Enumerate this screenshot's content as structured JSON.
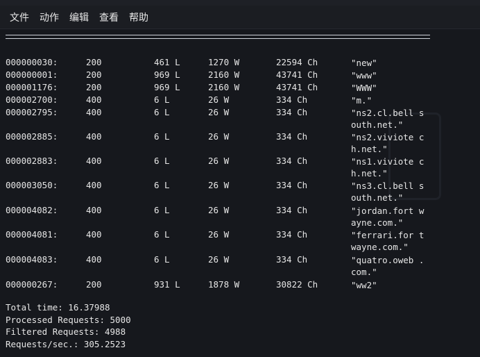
{
  "menu": {
    "items": [
      "文件",
      "动作",
      "编辑",
      "查看",
      "帮助"
    ]
  },
  "results": [
    {
      "id": "000000030:",
      "response": "200",
      "lines": "461 L",
      "words": "1270 W",
      "chars": "22594 Ch",
      "payload": "\"new\""
    },
    {
      "id": "000000001:",
      "response": "200",
      "lines": "969 L",
      "words": "2160 W",
      "chars": "43741 Ch",
      "payload": "\"www\""
    },
    {
      "id": "000001176:",
      "response": "200",
      "lines": "969 L",
      "words": "2160 W",
      "chars": "43741 Ch",
      "payload": "\"WWW\""
    },
    {
      "id": "000002700:",
      "response": "400",
      "lines": "6 L",
      "words": "26 W",
      "chars": "334 Ch",
      "payload": "\"m.\""
    },
    {
      "id": "000002795:",
      "response": "400",
      "lines": "6 L",
      "words": "26 W",
      "chars": "334 Ch",
      "payload": "\"ns2.cl.bell south.net.\""
    },
    {
      "id": "000002885:",
      "response": "400",
      "lines": "6 L",
      "words": "26 W",
      "chars": "334 Ch",
      "payload": "\"ns2.viviote ch.net.\""
    },
    {
      "id": "000002883:",
      "response": "400",
      "lines": "6 L",
      "words": "26 W",
      "chars": "334 Ch",
      "payload": "\"ns1.viviote ch.net.\""
    },
    {
      "id": "000003050:",
      "response": "400",
      "lines": "6 L",
      "words": "26 W",
      "chars": "334 Ch",
      "payload": "\"ns3.cl.bell south.net.\""
    },
    {
      "id": "000004082:",
      "response": "400",
      "lines": "6 L",
      "words": "26 W",
      "chars": "334 Ch",
      "payload": "\"jordan.fort wayne.com.\""
    },
    {
      "id": "000004081:",
      "response": "400",
      "lines": "6 L",
      "words": "26 W",
      "chars": "334 Ch",
      "payload": "\"ferrari.for twayne.com.\""
    },
    {
      "id": "000004083:",
      "response": "400",
      "lines": "6 L",
      "words": "26 W",
      "chars": "334 Ch",
      "payload": "\"quatro.oweb .com.\""
    },
    {
      "id": "000000267:",
      "response": "200",
      "lines": "931 L",
      "words": "1878 W",
      "chars": "30822 Ch",
      "payload": "\"ww2\""
    }
  ],
  "summary": {
    "total_time": "Total time: 16.37988",
    "processed": "Processed Requests: 5000",
    "filtered": "Filtered Requests: 4988",
    "rate": "Requests/sec.: 305.2523"
  }
}
